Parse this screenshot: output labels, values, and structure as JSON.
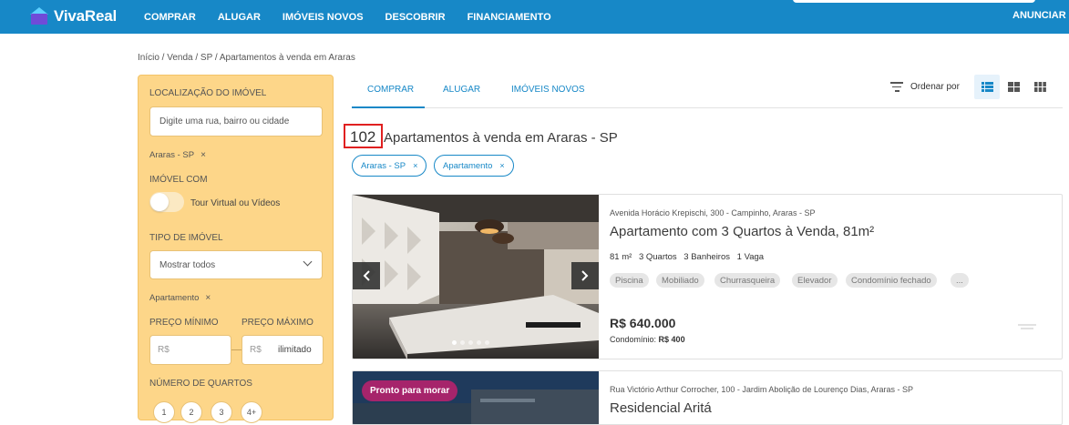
{
  "brand": {
    "name": "VivaReal",
    "color": "#1788c7"
  },
  "nav": {
    "items": [
      "COMPRAR",
      "ALUGAR",
      "IMÓVEIS NOVOS",
      "DESCOBRIR",
      "FINANCIAMENTO"
    ],
    "anunciar": "ANUNCIAR IM"
  },
  "breadcrumb": "Início / Venda / SP / Apartamentos à venda em Araras",
  "filters": {
    "location_label": "LOCALIZAÇÃO DO IMÓVEL",
    "location_placeholder": "Digite uma rua, bairro ou cidade",
    "location_chip": "Araras - SP",
    "imovel_com_label": "IMÓVEL COM",
    "tour_label": "Tour Virtual ou Vídeos",
    "tour_enabled": false,
    "tipo_label": "TIPO DE IMÓVEL",
    "tipo_value": "Mostrar todos",
    "tipo_chip": "Apartamento",
    "preco_min_label": "PREÇO MÍNIMO",
    "preco_max_label": "PREÇO MÁXIMO",
    "currency": "R$",
    "preco_max_value": "ilimitado",
    "quartos_label": "NÚMERO DE QUARTOS",
    "quartos_options": [
      "1",
      "2",
      "3",
      "4+"
    ]
  },
  "tabs": [
    {
      "label": "COMPRAR",
      "active": true
    },
    {
      "label": "ALUGAR",
      "active": false
    },
    {
      "label": "IMÓVEIS NOVOS",
      "active": false
    }
  ],
  "sort": {
    "label": "Ordenar por"
  },
  "results": {
    "count": "102",
    "title": "Apartamentos à venda em Araras - SP",
    "chips": [
      "Araras - SP",
      "Apartamento"
    ],
    "chip_close": "×"
  },
  "listings": [
    {
      "address": "Avenida Horácio Krepischi, 300 - Campinho, Araras - SP",
      "title": "Apartamento com 3 Quartos à Venda, 81m²",
      "area": "81 m²",
      "quartos": "3 Quartos",
      "banheiros": "3 Banheiros",
      "vagas": "1 Vaga",
      "amenities": [
        "Piscina",
        "Mobiliado",
        "Churrasqueira",
        "Elevador",
        "Condomínio fechado",
        "..."
      ],
      "price": "R$ 640.000",
      "condo_label": "Condomínio:",
      "condo_value": "R$ 400"
    },
    {
      "badge": "Pronto para morar",
      "address": "Rua Victório Arthur Corrocher, 100 - Jardim Abolição de Lourenço Dias, Araras - SP",
      "title": "Residencial Aritá"
    }
  ]
}
